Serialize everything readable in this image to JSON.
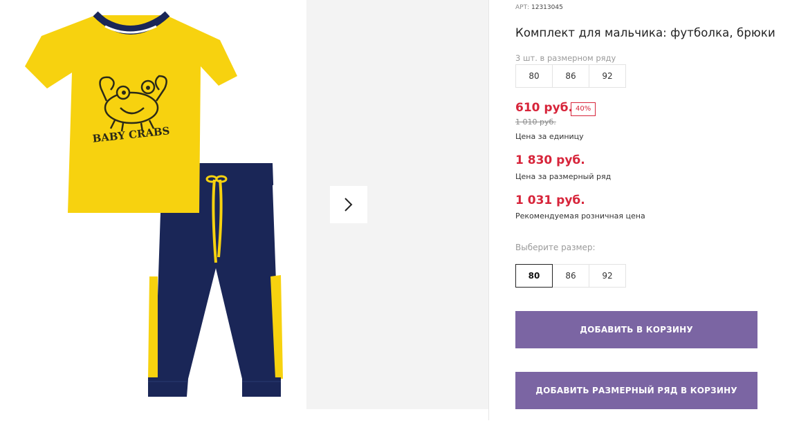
{
  "product": {
    "art_label": "АРТ:",
    "art_number": "12313045",
    "title": "Комплект для мальчика: футболка, брюки",
    "set_note": "3 шт. в размерном ряду",
    "set_sizes": [
      "80",
      "86",
      "92"
    ],
    "image_print_text": "BABY CRABS"
  },
  "prices": {
    "price": "610 руб.",
    "discount": "40%",
    "old_price": "1 010 руб.",
    "unit_caption": "Цена за единицу",
    "set_price": "1 830 руб.",
    "set_caption": "Цена за размерный ряд",
    "retail_price": "1 031 руб.",
    "retail_caption": "Рекомендуемая розничная цена"
  },
  "size_select": {
    "label": "Выберите размер:",
    "options": [
      "80",
      "86",
      "92"
    ],
    "selected": "80"
  },
  "buttons": {
    "add_to_cart": "ДОБАВИТЬ В КОРЗИНУ",
    "add_set_to_cart": "ДОБАВИТЬ РАЗМЕРНЫЙ РЯД В КОРЗИНУ"
  },
  "gallery": {
    "next_icon": "chevron-right-icon"
  },
  "colors": {
    "accent": "#7b65a3",
    "price_red": "#d7243a",
    "shirt_yellow": "#f7d20f",
    "navy": "#1a2657"
  }
}
